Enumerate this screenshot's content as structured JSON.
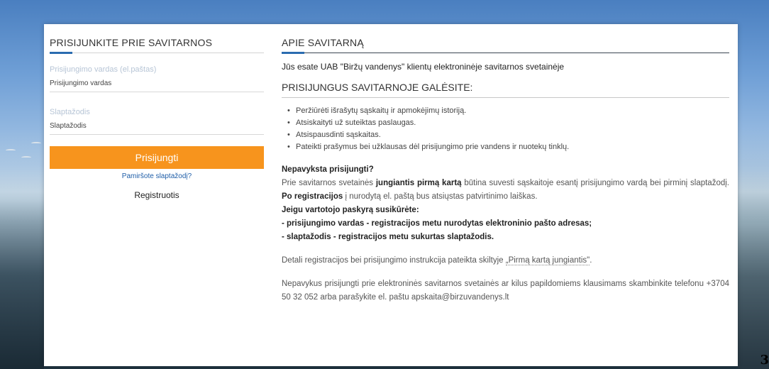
{
  "login": {
    "title": "PRISIJUNKITE PRIE SAVITARNOS",
    "username_label": "Prisijungimo vardas (el.paštas)",
    "username_placeholder": "Prisijungimo vardas",
    "password_label": "Slaptažodis",
    "password_placeholder": "Slaptažodis",
    "login_button": "Prisijungti",
    "forgot_link": "Pamiršote slaptažodį?",
    "register_link": "Registruotis"
  },
  "about": {
    "title": "APIE SAVITARNĄ",
    "intro": "Jūs esate UAB \"Biržų vandenys\" klientų elektroninėje savitarnos svetainėje",
    "features_title": "PRISIJUNGUS SAVITARNOJE GALĖSITE:",
    "features": [
      "Peržiūrėti išrašytų sąskaitų ir apmokėjimų istoriją.",
      "Atsiskaityti už suteiktas paslaugas.",
      "Atsispausdinti sąskaitas.",
      "Pateikti prašymus bei užklausas dėl prisijungimo prie vandens ir nuotekų tinklų."
    ],
    "help_heading": "Nepavyksta prisijungti?",
    "help_text_1": "Prie savitarnos svetainės ",
    "help_bold_1": "jungiantis pirmą kartą",
    "help_text_2": " būtina suvesti sąskaitoje esantį prisijungimo vardą bei pirminį slaptažodį. ",
    "help_bold_2": "Po registracijos",
    "help_text_3": " į nurodytą el. paštą bus atsiųstas patvirtinimo laiškas.",
    "help_line_1": "Jeigu vartotojo paskyrą susikūrėte:",
    "help_line_2": "- prisijungimo vardas - registracijos metu nurodytas elektroninio pašto adresas;",
    "help_line_3": "- slaptažodis - registracijos metu sukurtas slaptažodis.",
    "instr_text": "Detali registracijos bei prisijungimo instrukcija pateikta skiltyje ",
    "instr_link": "„Pirmą kartą jungiantis\"",
    "instr_end": ".",
    "contact_text": "Nepavykus prisijungti prie elektroninės savitarnos svetainės ar kilus papildomiems klausimams skambinkite telefonu +3704 50 32 052 arba parašykite el. paštu apskaita@birzuvandenys.lt"
  },
  "corner_mark": "3"
}
